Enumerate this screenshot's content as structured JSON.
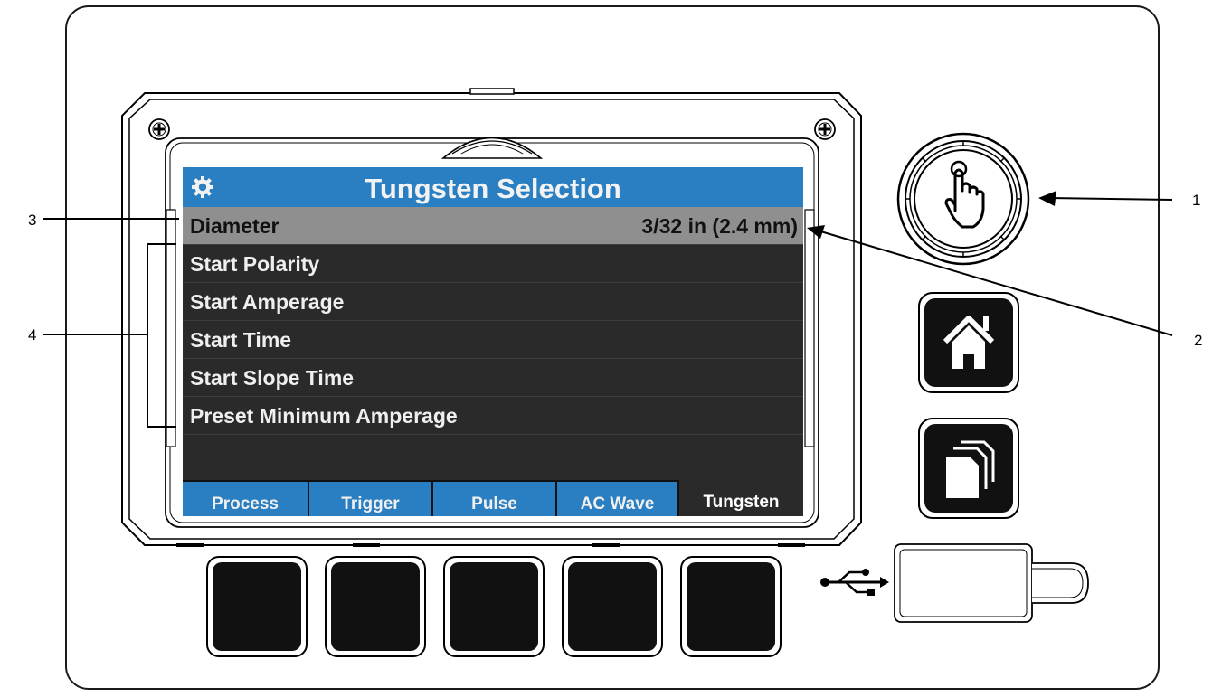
{
  "screen": {
    "title": "Tungsten Selection",
    "rows": [
      {
        "label": "Diameter",
        "value": "3/32 in (2.4 mm)",
        "selected": true
      },
      {
        "label": "Start Polarity",
        "value": ""
      },
      {
        "label": "Start Amperage",
        "value": ""
      },
      {
        "label": "Start Time",
        "value": ""
      },
      {
        "label": "Start Slope Time",
        "value": ""
      },
      {
        "label": "Preset Minimum Amperage",
        "value": ""
      }
    ],
    "tabs": [
      {
        "label": "Process"
      },
      {
        "label": "Trigger"
      },
      {
        "label": "Pulse"
      },
      {
        "label": "AC Wave"
      },
      {
        "label": "Tungsten",
        "active": true
      }
    ]
  },
  "callouts": {
    "c1": "1",
    "c2": "2",
    "c3": "3",
    "c4": "4"
  },
  "icons": {
    "settings": "gear-icon",
    "control_knob": "touch-hand-icon",
    "home": "home-icon",
    "pages": "stacked-pages-icon",
    "usb": "usb-icon"
  },
  "colors": {
    "title_bar": "#2a7fc2",
    "screen_bg": "#2a2a2a",
    "selected_row": "#8f8f8f"
  }
}
